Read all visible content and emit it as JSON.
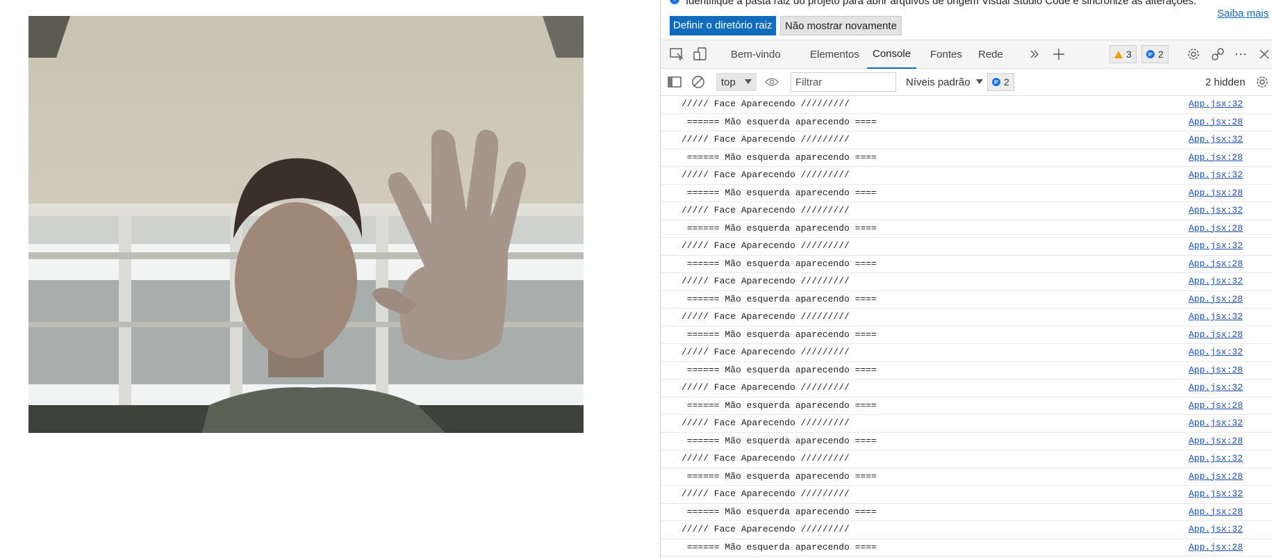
{
  "infobar": {
    "message": "Identifique a pasta raiz do projeto para abrir arquivos de origem Visual Studio Code e sincronize as alterações.",
    "learn_more": "Saiba mais",
    "primary_button": "Definir o diretório raiz",
    "secondary_button": "Não mostrar novamente"
  },
  "tabs": [
    {
      "label": "Bem-vindo"
    },
    {
      "label": "Elementos"
    },
    {
      "label": "Console"
    },
    {
      "label": "Fontes"
    },
    {
      "label": "Rede"
    }
  ],
  "issues": {
    "warnings": "3",
    "messages": "2"
  },
  "filterbar": {
    "context": "top",
    "filter_placeholder": "Filtrar",
    "levels": "Níveis padrão",
    "message_count": "2",
    "hidden": "2 hidden"
  },
  "console_rows": [
    {
      "text": "///// Face Aparecendo /////////",
      "source": "App.jsx:32"
    },
    {
      "text": " ====== Mão esquerda aparecendo ====",
      "source": "App.jsx:28"
    },
    {
      "text": "///// Face Aparecendo /////////",
      "source": "App.jsx:32"
    },
    {
      "text": " ====== Mão esquerda aparecendo ====",
      "source": "App.jsx:28"
    },
    {
      "text": "///// Face Aparecendo /////////",
      "source": "App.jsx:32"
    },
    {
      "text": " ====== Mão esquerda aparecendo ====",
      "source": "App.jsx:28"
    },
    {
      "text": "///// Face Aparecendo /////////",
      "source": "App.jsx:32"
    },
    {
      "text": " ====== Mão esquerda aparecendo ====",
      "source": "App.jsx:28"
    },
    {
      "text": "///// Face Aparecendo /////////",
      "source": "App.jsx:32"
    },
    {
      "text": " ====== Mão esquerda aparecendo ====",
      "source": "App.jsx:28"
    },
    {
      "text": "///// Face Aparecendo /////////",
      "source": "App.jsx:32"
    },
    {
      "text": " ====== Mão esquerda aparecendo ====",
      "source": "App.jsx:28"
    },
    {
      "text": "///// Face Aparecendo /////////",
      "source": "App.jsx:32"
    },
    {
      "text": " ====== Mão esquerda aparecendo ====",
      "source": "App.jsx:28"
    },
    {
      "text": "///// Face Aparecendo /////////",
      "source": "App.jsx:32"
    },
    {
      "text": " ====== Mão esquerda aparecendo ====",
      "source": "App.jsx:28"
    },
    {
      "text": "///// Face Aparecendo /////////",
      "source": "App.jsx:32"
    },
    {
      "text": " ====== Mão esquerda aparecendo ====",
      "source": "App.jsx:28"
    },
    {
      "text": "///// Face Aparecendo /////////",
      "source": "App.jsx:32"
    },
    {
      "text": " ====== Mão esquerda aparecendo ====",
      "source": "App.jsx:28"
    },
    {
      "text": "///// Face Aparecendo /////////",
      "source": "App.jsx:32"
    },
    {
      "text": " ====== Mão esquerda aparecendo ====",
      "source": "App.jsx:28"
    },
    {
      "text": "///// Face Aparecendo /////////",
      "source": "App.jsx:32"
    },
    {
      "text": " ====== Mão esquerda aparecendo ====",
      "source": "App.jsx:28"
    },
    {
      "text": "///// Face Aparecendo /////////",
      "source": "App.jsx:32"
    },
    {
      "text": " ====== Mão esquerda aparecendo ====",
      "source": "App.jsx:28"
    }
  ],
  "colors": {
    "accent": "#0f6cbd",
    "link": "#1a4fb3",
    "warning": "#f0a30a",
    "info": "#1a73e8"
  },
  "icons": [
    "inspect-icon",
    "device-emulation-icon",
    "more-tabs-icon",
    "add-tab-icon",
    "warning-icon",
    "message-icon",
    "settings-icon",
    "connect-icon",
    "more-icon",
    "close-icon",
    "sidebar-icon",
    "clear-icon",
    "eye-icon",
    "chevron-down-icon",
    "info-icon"
  ]
}
